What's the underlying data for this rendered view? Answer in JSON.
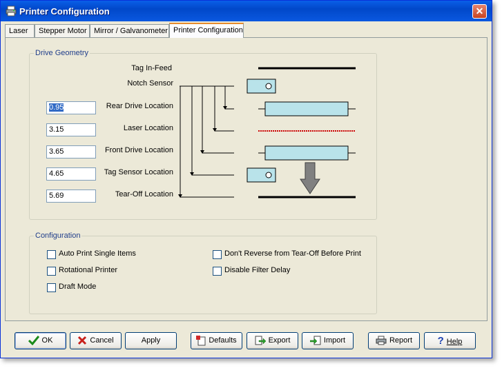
{
  "window": {
    "title": "Printer Configuration",
    "close_glyph": "✕"
  },
  "tabs": [
    {
      "label": "Laser",
      "active": false
    },
    {
      "label": "Stepper Motor",
      "active": false
    },
    {
      "label": "Mirror / Galvanometer",
      "active": false
    },
    {
      "label": "Printer Configuration",
      "active": true
    }
  ],
  "drive_geometry": {
    "label": "Drive Geometry",
    "tag_infeed_label": "Tag In-Feed",
    "notch_sensor_label": "Notch Sensor",
    "fields": [
      {
        "label": "Rear Drive Location",
        "value": "0.95",
        "selected": true
      },
      {
        "label": "Laser Location",
        "value": "3.15",
        "selected": false
      },
      {
        "label": "Front Drive Location",
        "value": "3.65",
        "selected": false
      },
      {
        "label": "Tag Sensor Location",
        "value": "4.65",
        "selected": false
      },
      {
        "label": "Tear-Off Location",
        "value": "5.69",
        "selected": false
      }
    ]
  },
  "configuration": {
    "label": "Configuration",
    "checkboxes": [
      {
        "label": "Auto Print Single Items",
        "checked": false
      },
      {
        "label": "Rotational Printer",
        "checked": false
      },
      {
        "label": "Draft Mode",
        "checked": false
      },
      {
        "label": "Don't Reverse from Tear-Off Before Print",
        "checked": false
      },
      {
        "label": "Disable Filter Delay",
        "checked": false
      }
    ]
  },
  "buttons": {
    "ok": "OK",
    "cancel": "Cancel",
    "apply": "Apply",
    "defaults": "Defaults",
    "export": "Export",
    "import": "Import",
    "report": "Report",
    "help": "Help"
  },
  "colors": {
    "titlebar": "#0148c9",
    "roller_fill": "#b9e3ea",
    "laser_line": "#cc0000",
    "arrow_fill": "#808080"
  }
}
